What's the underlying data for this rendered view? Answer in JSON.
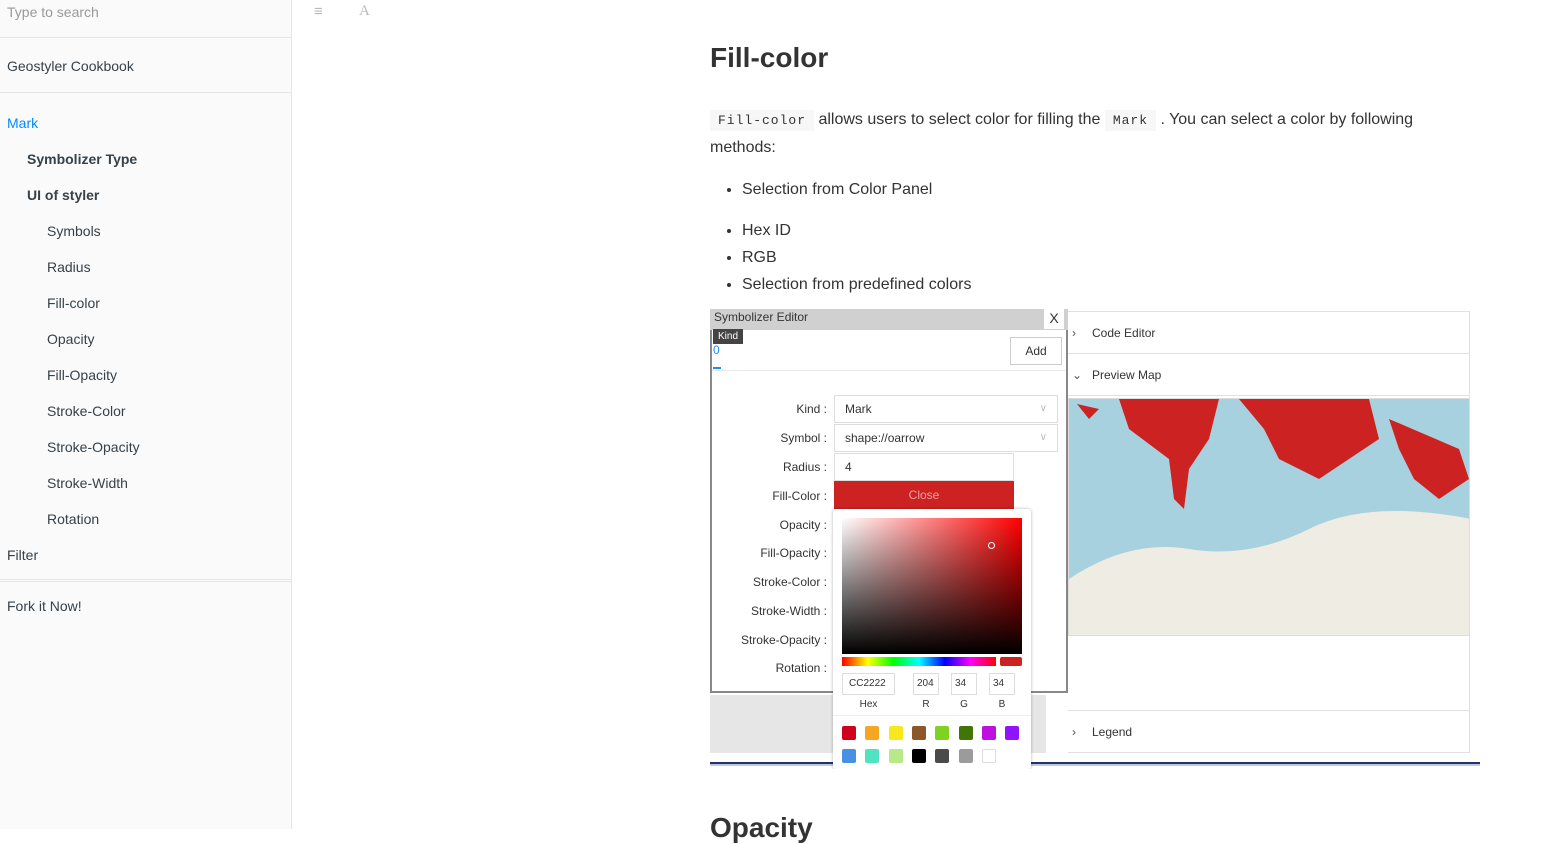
{
  "search": {
    "placeholder": "Type to search"
  },
  "sidebar": {
    "items": [
      {
        "label": "Geostyler Cookbook"
      },
      {
        "label": "Mark"
      },
      {
        "label": "Symbolizer Type"
      },
      {
        "label": "UI of styler"
      },
      {
        "label": "Symbols"
      },
      {
        "label": "Radius"
      },
      {
        "label": "Fill-color"
      },
      {
        "label": "Opacity"
      },
      {
        "label": "Fill-Opacity"
      },
      {
        "label": "Stroke-Color"
      },
      {
        "label": "Stroke-Opacity"
      },
      {
        "label": "Stroke-Width"
      },
      {
        "label": "Rotation"
      },
      {
        "label": "Filter"
      },
      {
        "label": "Fork it Now!"
      }
    ]
  },
  "main": {
    "title": "Fill-color",
    "code1": "Fill-color",
    "text1": " allows users to select color for filling the ",
    "code2": "Mark",
    "text2": " . You can select a color by following methods:",
    "bullets": [
      "Selection from Color Panel",
      "Hex ID",
      "RGB",
      "Selection from predefined colors"
    ],
    "next_heading": "Opacity"
  },
  "editor": {
    "title": "Symbolizer Editor",
    "close": "X",
    "tooltip": "Kind",
    "tab": "0",
    "add": "Add",
    "labels": [
      "Kind :",
      "Symbol :",
      "Radius :",
      "Fill-Color :",
      "Opacity :",
      "Fill-Opacity :",
      "Stroke-Color :",
      "Stroke-Width :",
      "Stroke-Opacity :",
      "Rotation :"
    ],
    "kind": "Mark",
    "symbol": "shape://oarrow",
    "radius": "4",
    "close_button": "Close"
  },
  "picker": {
    "hex": "CC2222",
    "r": "204",
    "g": "34",
    "b": "34",
    "hex_label": "Hex",
    "r_label": "R",
    "g_label": "G",
    "b_label": "B",
    "swatches": [
      "#d0021b",
      "#f5a623",
      "#f8e71c",
      "#8b572a",
      "#7ed321",
      "#417505",
      "#bd10e0",
      "#9013fe",
      "#4a90e2",
      "#50e3c2",
      "#b8e986",
      "#000000",
      "#4a4a4a",
      "#9b9b9b",
      "#ffffff"
    ]
  },
  "panels": {
    "code_editor": "Code Editor",
    "preview_map": "Preview Map",
    "legend": "Legend"
  }
}
